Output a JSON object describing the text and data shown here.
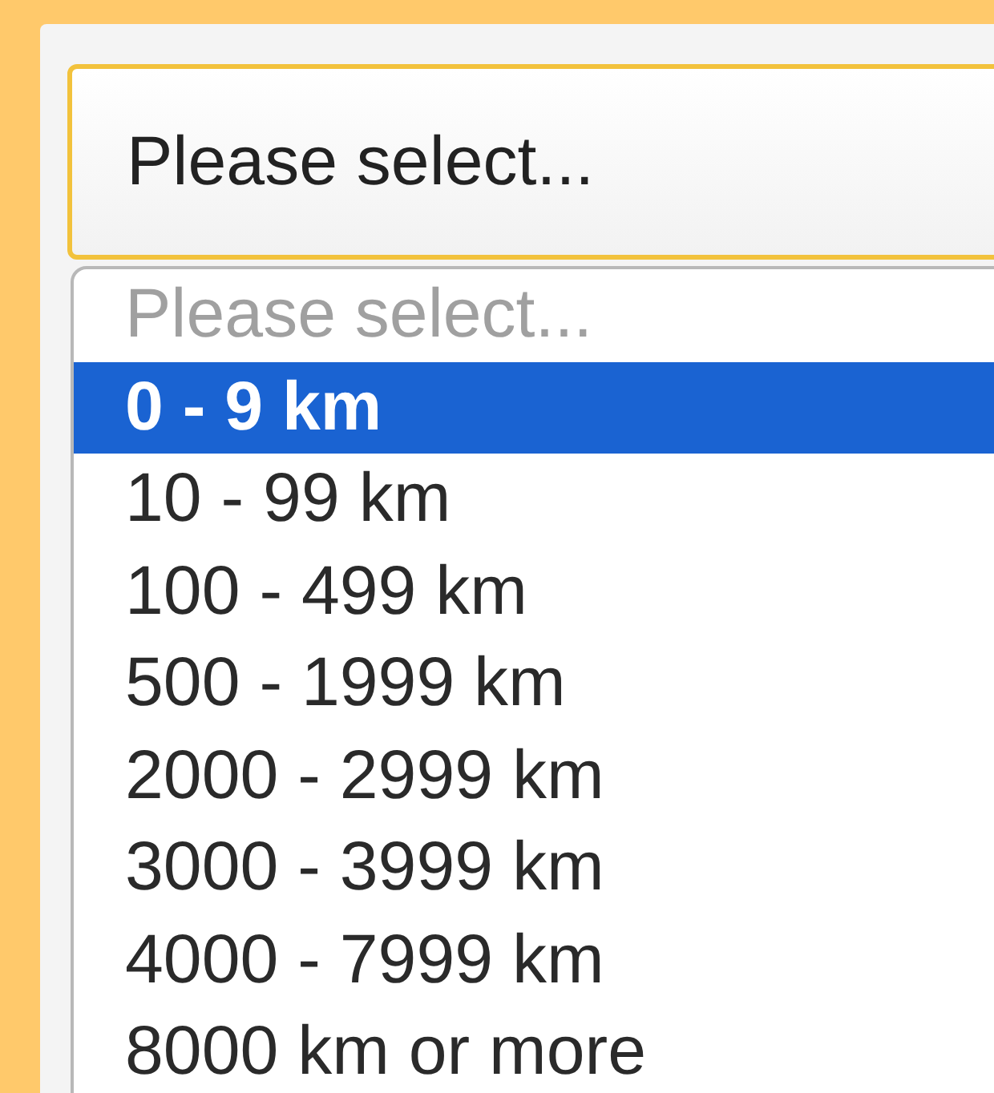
{
  "select": {
    "value": "Please select..."
  },
  "options": [
    {
      "label": "Please select...",
      "disabled": true,
      "selected": false
    },
    {
      "label": "0 - 9 km",
      "disabled": false,
      "selected": true
    },
    {
      "label": "10 - 99 km",
      "disabled": false,
      "selected": false
    },
    {
      "label": "100 - 499 km",
      "disabled": false,
      "selected": false
    },
    {
      "label": "500 - 1999 km",
      "disabled": false,
      "selected": false
    },
    {
      "label": "2000 - 2999 km",
      "disabled": false,
      "selected": false
    },
    {
      "label": "3000 - 3999 km",
      "disabled": false,
      "selected": false
    },
    {
      "label": "4000 - 7999 km",
      "disabled": false,
      "selected": false
    },
    {
      "label": "8000 km or more",
      "disabled": false,
      "selected": false
    }
  ]
}
